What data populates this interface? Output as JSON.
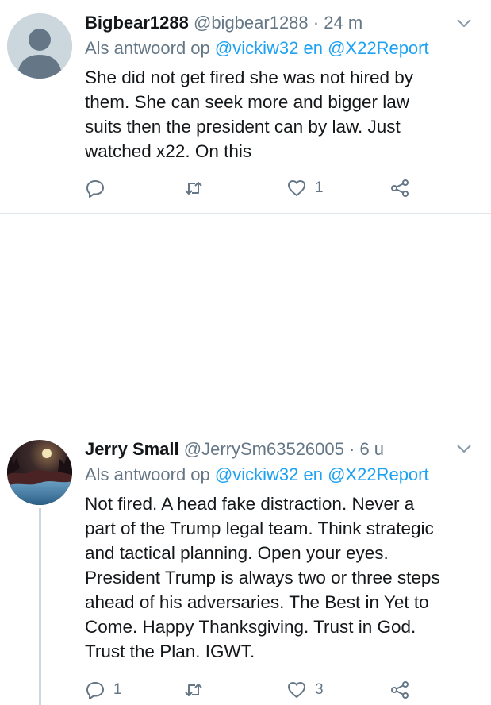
{
  "tweets": [
    {
      "name": "Bigbear1288",
      "handle": "@bigbear1288",
      "dot": "·",
      "time": "24 m",
      "reply_prefix": "Als antwoord op",
      "mention1": "@vickiw32",
      "reply_joiner": "en",
      "mention2": "@X22Report",
      "text": "She did not get fired she was not hired by\nthem. She can seek more and bigger law\nsuits then the president  can by law. Just\nwatched x22. On this",
      "reply_count": "",
      "retweet_count": "",
      "like_count": "1"
    },
    {
      "name": "Jerry Small",
      "handle": "@JerrySm63526005",
      "dot": "·",
      "time": "6 u",
      "reply_prefix": "Als antwoord op",
      "mention1": "@vickiw32",
      "reply_joiner": "en",
      "mention2": "@X22Report",
      "text": "Not fired. A head fake distraction. Never a\npart of the Trump legal team. Think strategic\nand tactical planning. Open your eyes.\nPresident Trump is always two or three steps\nahead of his adversaries. The Best in Yet to\nCome. Happy Thanksgiving. Trust in God.\nTrust the Plan. IGWT.",
      "reply_count": "1",
      "retweet_count": "",
      "like_count": "3"
    }
  ],
  "colors": {
    "text": "#14171a",
    "muted": "#657786",
    "link": "#1da1f2",
    "divider": "#e1e8ed"
  },
  "icons": {
    "reply": "reply-icon",
    "retweet": "retweet-icon",
    "like": "heart-icon",
    "share": "share-icon",
    "menu": "chevron-down-icon"
  }
}
